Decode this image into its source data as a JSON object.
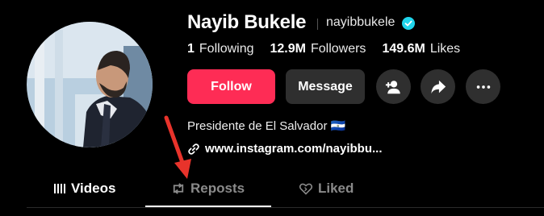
{
  "profile": {
    "display_name": "Nayib Bukele",
    "username": "nayibbukele",
    "verified": true,
    "bio": "Presidente de El Salvador 🇸🇻",
    "link": "www.instagram.com/nayibbu...",
    "avatar_icon": "profile-photo"
  },
  "stats": [
    {
      "value": "1",
      "label": "Following"
    },
    {
      "value": "12.9M",
      "label": "Followers"
    },
    {
      "value": "149.6M",
      "label": "Likes"
    }
  ],
  "actions": {
    "follow": "Follow",
    "message": "Message",
    "icons": [
      "add-friend-icon",
      "share-icon",
      "more-icon"
    ]
  },
  "tabs": [
    {
      "label": "Videos",
      "icon": "grid-icon",
      "active": false
    },
    {
      "label": "Reposts",
      "icon": "repost-icon",
      "active": true
    },
    {
      "label": "Liked",
      "icon": "heart-icon",
      "active": false
    }
  ],
  "colors": {
    "follow": "#fe2c55",
    "verified": "#20d5ec",
    "annotation_arrow": "#e8332b"
  }
}
